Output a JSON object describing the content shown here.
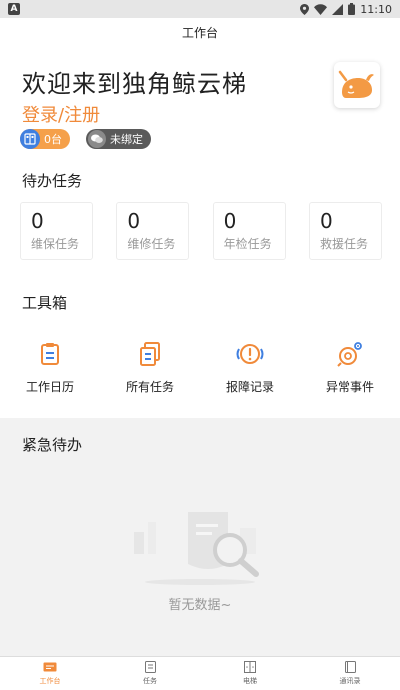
{
  "status_bar": {
    "time": "11:10",
    "left_icon": "A"
  },
  "app_bar": {
    "title": "工作台"
  },
  "header": {
    "welcome": "欢迎来到独角鲸云梯",
    "login_link": "登录/注册",
    "elevator_badge": "0台",
    "wechat_badge": "未绑定",
    "accent_color": "#f08a3a"
  },
  "tasks": {
    "title": "待办任务",
    "items": [
      {
        "count": "0",
        "label": "维保任务"
      },
      {
        "count": "0",
        "label": "维修任务"
      },
      {
        "count": "0",
        "label": "年检任务"
      },
      {
        "count": "0",
        "label": "救援任务"
      }
    ]
  },
  "toolbox": {
    "title": "工具箱",
    "items": [
      {
        "label": "工作日历",
        "icon": "calendar-icon"
      },
      {
        "label": "所有任务",
        "icon": "tasks-icon"
      },
      {
        "label": "报障记录",
        "icon": "alert-icon"
      },
      {
        "label": "异常事件",
        "icon": "abnormal-icon"
      }
    ]
  },
  "urgent": {
    "title": "紧急待办",
    "empty_text": "暂无数据~"
  },
  "tabbar": {
    "items": [
      {
        "label": "工作台",
        "icon": "workbench-icon",
        "active": true
      },
      {
        "label": "任务",
        "icon": "task-tab-icon",
        "active": false
      },
      {
        "label": "电梯",
        "icon": "elevator-icon",
        "active": false
      },
      {
        "label": "通讯录",
        "icon": "contacts-icon",
        "active": false
      }
    ]
  }
}
